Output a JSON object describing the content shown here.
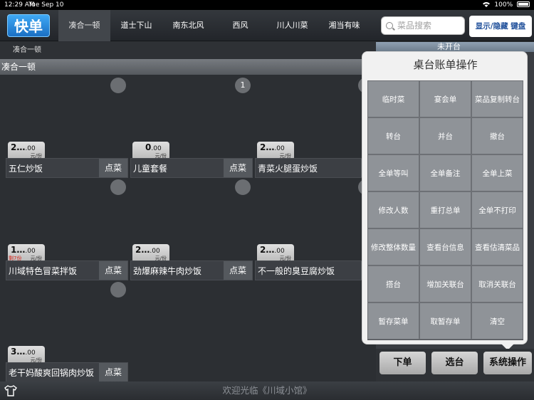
{
  "status_bar": {
    "time": "12:29 AM",
    "date": "Tue Sep 10",
    "battery": "100%"
  },
  "header": {
    "logo": "快单",
    "tabs": [
      "凑合一顿",
      "道士下山",
      "南东北风",
      "西风",
      "川人川菜",
      "湘当有味"
    ],
    "search_placeholder": "菜品搜索",
    "toggle_keyboard": "显示/隐藏 键盘"
  },
  "breadcrumb": "凑合一顿",
  "table_status": "未开台",
  "group_title": "凑合一顿",
  "grid": {
    "dots": [
      null,
      "1",
      null,
      null,
      null,
      null,
      null
    ],
    "dishes": [
      {
        "name": "五仁炒饭",
        "price_main": "2…",
        "price_dec": ".00",
        "unit": "元/份",
        "tag": "",
        "order": "点菜"
      },
      {
        "name": "儿童套餐",
        "price_main": "0",
        "price_dec": ".00",
        "unit": "元/份",
        "tag": "",
        "order": "点菜"
      },
      {
        "name": "青菜火腿蛋炒饭",
        "price_main": "2…",
        "price_dec": ".00",
        "unit": "元/份",
        "tag": "",
        "order": "点菜"
      },
      {
        "name": "川域特色冒菜拌饭",
        "price_main": "1…",
        "price_dec": ".00",
        "unit": "元/份",
        "tag": "剩7份",
        "order": "点菜"
      },
      {
        "name": "劲爆麻辣牛肉炒饭",
        "price_main": "2…",
        "price_dec": ".00",
        "unit": "元/份",
        "tag": "",
        "order": "点菜"
      },
      {
        "name": "不一般的臭豆腐炒饭",
        "price_main": "2…",
        "price_dec": ".00",
        "unit": "元/份",
        "tag": "",
        "order": "点菜"
      },
      {
        "name": "老干妈酸爽回锅肉炒饭",
        "price_main": "3…",
        "price_dec": ".00",
        "unit": "元/份",
        "tag": "",
        "order": "点菜"
      }
    ]
  },
  "popover": {
    "title": "桌台账单操作",
    "buttons": [
      "临时菜",
      "宴会单",
      "菜品复制转台",
      "转台",
      "并台",
      "撤台",
      "全单等叫",
      "全单备注",
      "全单上菜",
      "修改人数",
      "重打总单",
      "全单不打印",
      "修改整体数量",
      "查看台信息",
      "查看估清菜品",
      "搭台",
      "增加关联台",
      "取消关联台",
      "暂存菜单",
      "取暂存单",
      "清空"
    ]
  },
  "actions": {
    "place_order": "下单",
    "select_table": "选台",
    "system": "系统操作"
  },
  "footer": {
    "welcome": "欢迎光临《川域小馆》"
  },
  "colors": {
    "brand": "#2b8ce0",
    "background": "#2c2f33"
  }
}
